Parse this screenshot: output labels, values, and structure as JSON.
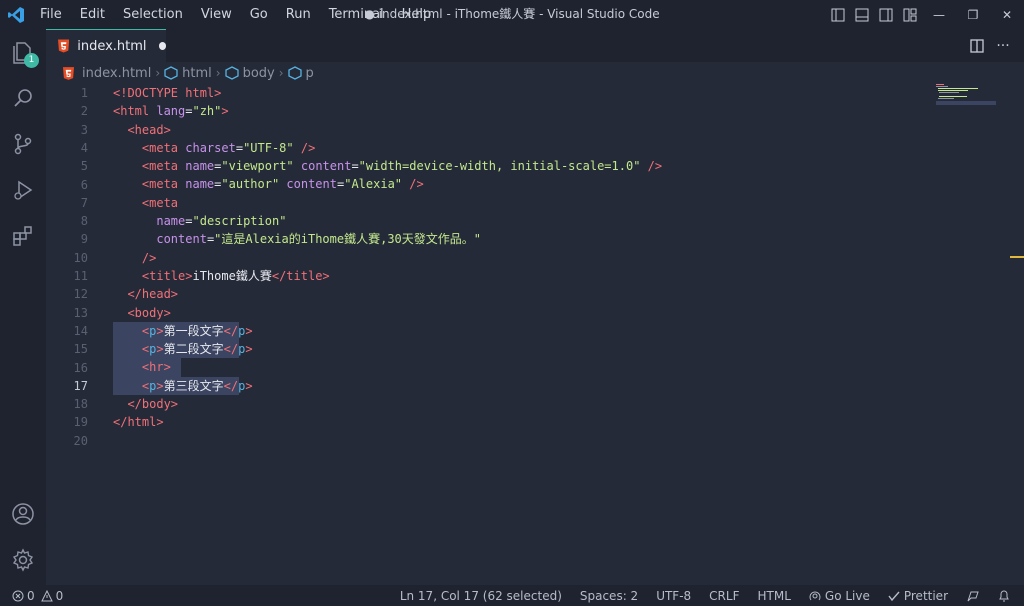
{
  "menu": [
    "File",
    "Edit",
    "Selection",
    "View",
    "Go",
    "Run",
    "Terminal",
    "Help"
  ],
  "window_title": "● index.html - iThome鐵人賽 - Visual Studio Code",
  "tab": {
    "name": "index.html",
    "dirty": true
  },
  "explorer_badge": "1",
  "breadcrumb": [
    "index.html",
    "html",
    "body",
    "p"
  ],
  "code_lines": [
    [
      [
        "t-kw",
        "<!DOCTYPE"
      ],
      [
        "t-tag",
        " html"
      ],
      [
        "t-kw",
        ">"
      ]
    ],
    [
      [
        "t-kw",
        "<html"
      ],
      [
        "t-attr",
        " lang"
      ],
      [
        "t-txt",
        "="
      ],
      [
        "t-str",
        "\"zh\""
      ],
      [
        "t-kw",
        ">"
      ]
    ],
    [
      [
        "t-txt",
        "  "
      ],
      [
        "t-kw",
        "<head>"
      ]
    ],
    [
      [
        "t-txt",
        "    "
      ],
      [
        "t-kw",
        "<meta"
      ],
      [
        "t-attr",
        " charset"
      ],
      [
        "t-txt",
        "="
      ],
      [
        "t-str",
        "\"UTF-8\""
      ],
      [
        "t-kw",
        " />"
      ]
    ],
    [
      [
        "t-txt",
        "    "
      ],
      [
        "t-kw",
        "<meta"
      ],
      [
        "t-attr",
        " name"
      ],
      [
        "t-txt",
        "="
      ],
      [
        "t-str",
        "\"viewport\""
      ],
      [
        "t-attr",
        " content"
      ],
      [
        "t-txt",
        "="
      ],
      [
        "t-str",
        "\"width=device-width, initial-scale=1.0\""
      ],
      [
        "t-kw",
        " />"
      ]
    ],
    [
      [
        "t-txt",
        "    "
      ],
      [
        "t-kw",
        "<meta"
      ],
      [
        "t-attr",
        " name"
      ],
      [
        "t-txt",
        "="
      ],
      [
        "t-str",
        "\"author\""
      ],
      [
        "t-attr",
        " content"
      ],
      [
        "t-txt",
        "="
      ],
      [
        "t-str",
        "\"Alexia\""
      ],
      [
        "t-kw",
        " />"
      ]
    ],
    [
      [
        "t-txt",
        "    "
      ],
      [
        "t-kw",
        "<meta"
      ]
    ],
    [
      [
        "t-txt",
        "      "
      ],
      [
        "t-attr",
        "name"
      ],
      [
        "t-txt",
        "="
      ],
      [
        "t-str",
        "\"description\""
      ]
    ],
    [
      [
        "t-txt",
        "      "
      ],
      [
        "t-attr",
        "content"
      ],
      [
        "t-txt",
        "="
      ],
      [
        "t-str",
        "\"這是Alexia的iThome鐵人賽,30天發文作品。\""
      ]
    ],
    [
      [
        "t-txt",
        "    "
      ],
      [
        "t-kw",
        "/>"
      ]
    ],
    [
      [
        "t-txt",
        "    "
      ],
      [
        "t-kw",
        "<title>"
      ],
      [
        "t-txt",
        "iThome鐵人賽"
      ],
      [
        "t-kw",
        "</title>"
      ]
    ],
    [
      [
        "t-txt",
        "  "
      ],
      [
        "t-kw",
        "</head>"
      ]
    ],
    [
      [
        "t-txt",
        "  "
      ],
      [
        "t-kw",
        "<body>"
      ]
    ],
    [
      [
        "t-txt",
        "    "
      ],
      [
        "t-kw",
        "<"
      ],
      [
        "t-p",
        "p"
      ],
      [
        "t-kw",
        ">"
      ],
      [
        "t-txt",
        "第一段文字"
      ],
      [
        "t-kw",
        "</"
      ],
      [
        "t-p",
        "p"
      ],
      [
        "t-kw",
        ">"
      ]
    ],
    [
      [
        "t-txt",
        "    "
      ],
      [
        "t-kw",
        "<"
      ],
      [
        "t-p",
        "p"
      ],
      [
        "t-kw",
        ">"
      ],
      [
        "t-txt",
        "第二段文字"
      ],
      [
        "t-kw",
        "</"
      ],
      [
        "t-p",
        "p"
      ],
      [
        "t-kw",
        ">"
      ]
    ],
    [
      [
        "t-txt",
        "    "
      ],
      [
        "t-kw",
        "<hr>"
      ]
    ],
    [
      [
        "t-txt",
        "    "
      ],
      [
        "t-kw",
        "<"
      ],
      [
        "t-p",
        "p"
      ],
      [
        "t-kw",
        ">"
      ],
      [
        "t-txt",
        "第三段文字"
      ],
      [
        "t-kw",
        "</"
      ],
      [
        "t-p",
        "p"
      ],
      [
        "t-kw",
        ">"
      ]
    ],
    [
      [
        "t-txt",
        "  "
      ],
      [
        "t-kw",
        "</body>"
      ]
    ],
    [
      [
        "t-kw",
        "</html>"
      ]
    ],
    []
  ],
  "active_line": 17,
  "selected_lines": [
    14,
    15,
    16,
    17
  ],
  "status": {
    "errors": "0",
    "warnings": "0",
    "position": "Ln 17, Col 17 (62 selected)",
    "spaces": "Spaces: 2",
    "encoding": "UTF-8",
    "eol": "CRLF",
    "language": "HTML",
    "golive": "Go Live",
    "prettier": "Prettier"
  },
  "colors": {
    "accent": "#3fb9a6",
    "tag": "#f07178",
    "string": "#c3e88d",
    "attr": "#c792ea"
  }
}
